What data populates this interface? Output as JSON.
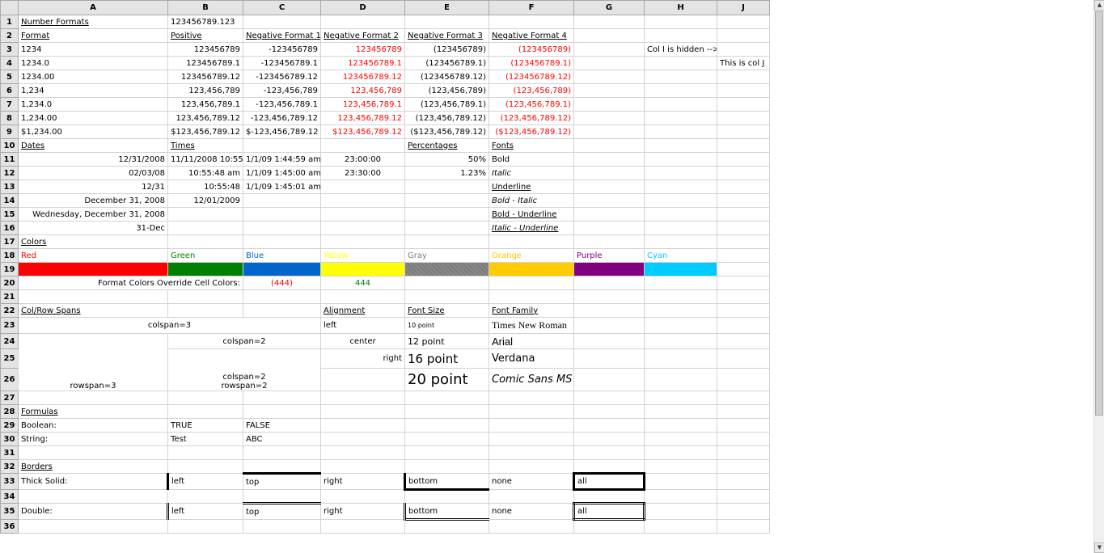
{
  "columns": [
    "A",
    "B",
    "C",
    "D",
    "E",
    "F",
    "G",
    "H",
    "J"
  ],
  "rows": [
    "1",
    "2",
    "3",
    "4",
    "5",
    "6",
    "7",
    "8",
    "9",
    "10",
    "11",
    "12",
    "13",
    "14",
    "15",
    "16",
    "17",
    "18",
    "19",
    "20",
    "21",
    "22",
    "23",
    "24",
    "25",
    "26",
    "27",
    "28",
    "29",
    "30",
    "31",
    "32",
    "33",
    "34",
    "35",
    "36"
  ],
  "nf": {
    "title": "Number Formats",
    "b1": "123456789.123",
    "format": "Format",
    "positive": "Positive",
    "neg1": "Negative Format 1",
    "neg2": "Negative Format 2",
    "neg3": "Negative Format 3",
    "neg4": "Negative Format 4",
    "rows": [
      [
        "1234",
        "123456789",
        "-123456789",
        "123456789",
        "(123456789)",
        "(123456789)"
      ],
      [
        "1234.0",
        "123456789.1",
        "-123456789.1",
        "123456789.1",
        "(123456789.1)",
        "(123456789.1)"
      ],
      [
        "1234.00",
        "123456789.12",
        "-123456789.12",
        "123456789.12",
        "(123456789.12)",
        "(123456789.12)"
      ],
      [
        "1,234",
        "123,456,789",
        "-123,456,789",
        "123,456,789",
        "(123,456,789)",
        "(123,456,789)"
      ],
      [
        "1,234.0",
        "123,456,789.1",
        "-123,456,789.1",
        "123,456,789.1",
        "(123,456,789.1)",
        "(123,456,789.1)"
      ],
      [
        "1,234.00",
        "123,456,789.12",
        "-123,456,789.12",
        "123,456,789.12",
        "(123,456,789.12)",
        "(123,456,789.12)"
      ],
      [
        "$1,234.00",
        "$123,456,789.12",
        "$-123,456,789.12",
        "$123,456,789.12",
        "($123,456,789.12)",
        "($123,456,789.12)"
      ]
    ],
    "hidden_note": "Col I is hidden -->",
    "col_j": "This is col J"
  },
  "dates": {
    "title": "Dates",
    "values": [
      "12/31/2008",
      "02/03/08",
      "12/31",
      "December 31, 2008",
      "Wednesday, December 31, 2008",
      "31-Dec"
    ]
  },
  "times": {
    "title": "Times",
    "b": [
      "11/11/2008 10:55",
      "10:55:48 am",
      "10:55:48",
      "12/01/2009"
    ],
    "c": [
      "1/1/09 1:44:59 am",
      "1/1/09 1:45:00 am",
      "1/1/09 1:45:01 am"
    ],
    "d": [
      "23:00:00",
      "23:30:00"
    ]
  },
  "percentages": {
    "title": "Percentages",
    "values": [
      "50%",
      "1.23%"
    ]
  },
  "fonts": {
    "title": "Fonts",
    "bold": "Bold",
    "italic": "Italic",
    "underline": "Underline",
    "bold_italic": "Bold - Italic",
    "bold_underline": "Bold - Underline",
    "italic_underline": "Italic - Underline"
  },
  "colors": {
    "title": "Colors",
    "items": [
      {
        "name": "Red",
        "hex": "#ff0000"
      },
      {
        "name": "Green",
        "hex": "#008000"
      },
      {
        "name": "Blue",
        "hex": "#0066cc"
      },
      {
        "name": "Yellow",
        "hex": "#ffff00"
      },
      {
        "name": "Gray",
        "hex": "#808080"
      },
      {
        "name": "Orange",
        "hex": "#ffcc00"
      },
      {
        "name": "Purple",
        "hex": "#800080"
      },
      {
        "name": "Cyan",
        "hex": "#00ccff"
      }
    ],
    "override_label": "Format Colors Override Cell Colors:",
    "override_red": "(444)",
    "override_green": "444"
  },
  "spans": {
    "title": "Col/Row Spans",
    "colspan3": "colspan=3",
    "colspan2": "colspan=2",
    "colspan2_l1": "colspan=2",
    "colspan2_l2": "rowspan=2",
    "rowspan3": "rowspan=3"
  },
  "alignment": {
    "title": "Alignment",
    "left": "left",
    "center": "center",
    "right": "right"
  },
  "fontsize": {
    "title": "Font Size",
    "s10": "10 point",
    "s12": "12 point",
    "s16": "16 point",
    "s20": "20 point"
  },
  "fontfamily": {
    "title": "Font Family",
    "times": "Times New Roman",
    "arial": "Arial",
    "verdana": "Verdana",
    "comic": "Comic Sans MS"
  },
  "formulas": {
    "title": "Formulas",
    "boolean": "Boolean:",
    "t": "TRUE",
    "f": "FALSE",
    "string": "String:",
    "test": "Test",
    "abc": "ABC"
  },
  "borders": {
    "title": "Borders",
    "thick": "Thick Solid:",
    "double": "Double:",
    "left": "left",
    "top": "top",
    "right": "right",
    "bottom": "bottom",
    "none": "none",
    "all": "all"
  }
}
